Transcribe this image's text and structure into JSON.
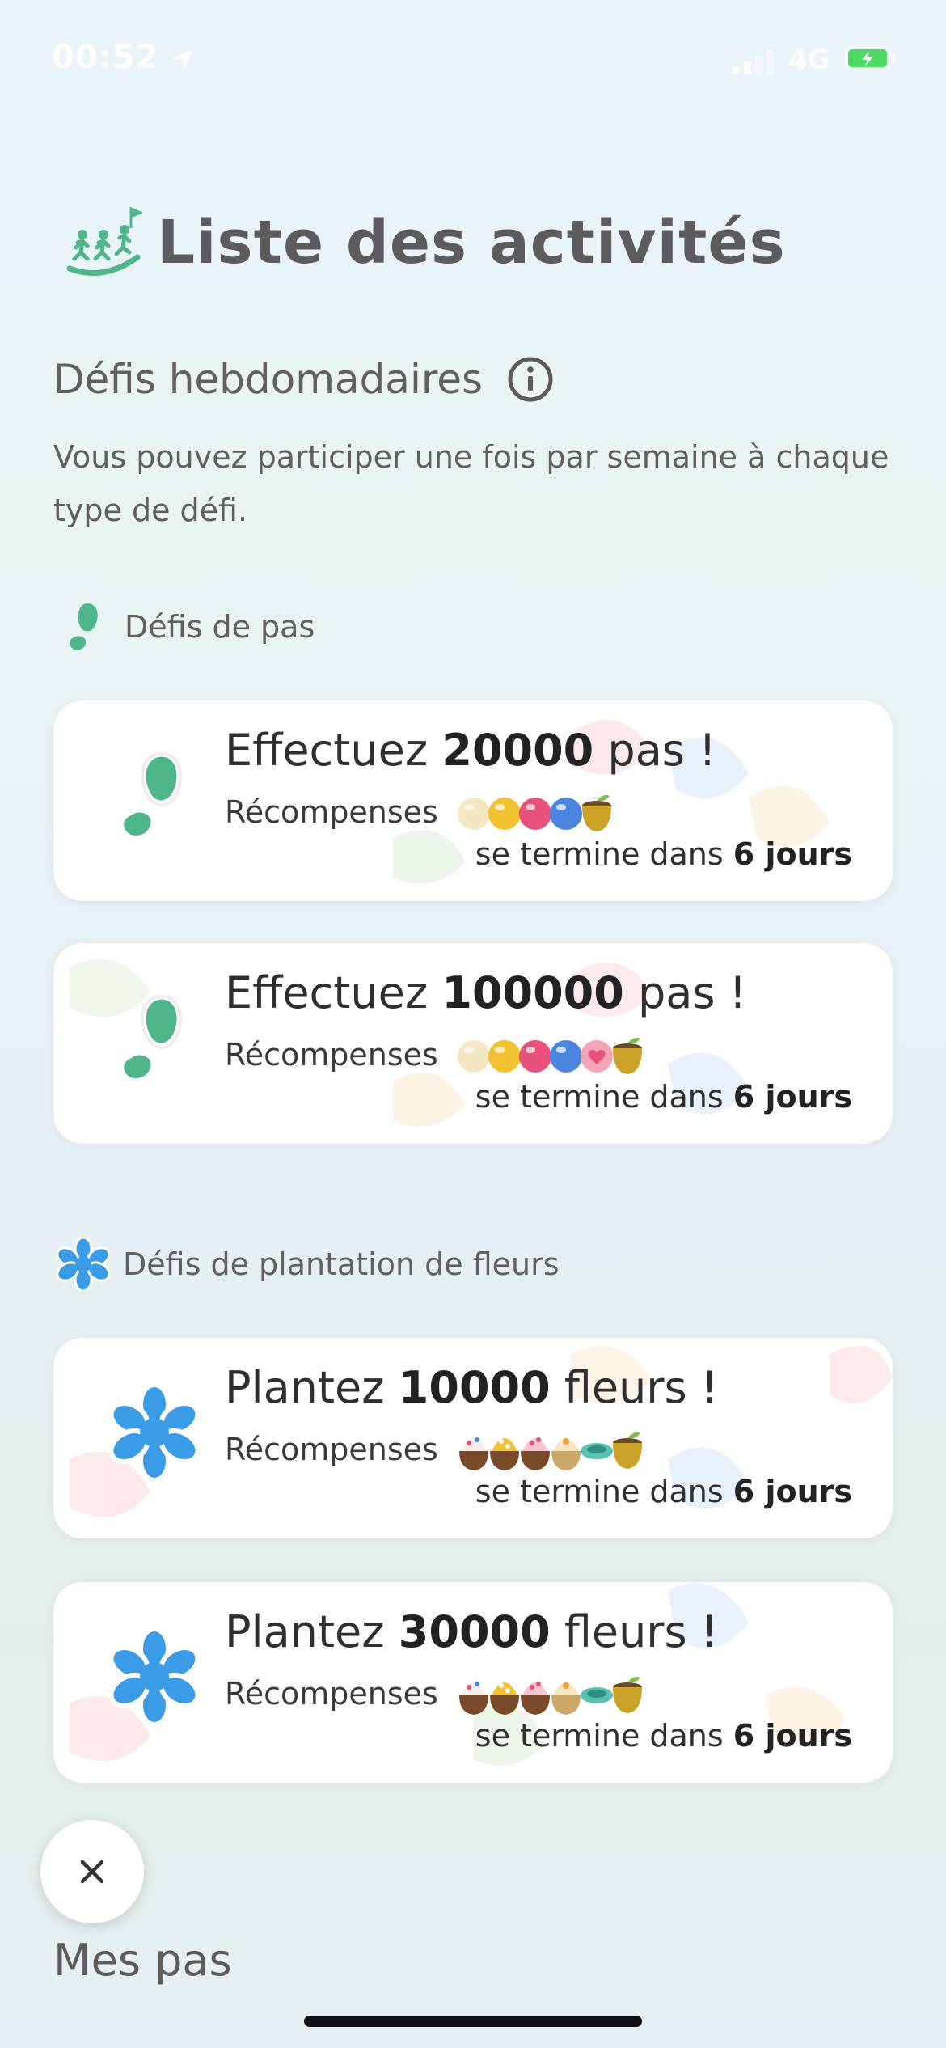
{
  "status_bar": {
    "time": "00:52",
    "network": "4G"
  },
  "header": {
    "title": "Liste des activités",
    "icon": "running-people-icon"
  },
  "weekly": {
    "title": "Défis hebdomadaires",
    "description": "Vous pouvez participer une fois par semaine à chaque type de défi."
  },
  "steps_group": {
    "label": "Défis de pas",
    "cards": [
      {
        "prefix": "Effectuez ",
        "number": "20000",
        "suffix": " pas !",
        "rewards_label": "Récompenses",
        "deadline_prefix": "se termine dans ",
        "deadline_value": "6 jours"
      },
      {
        "prefix": "Effectuez ",
        "number": "100000",
        "suffix": " pas !",
        "rewards_label": "Récompenses",
        "deadline_prefix": "se termine dans ",
        "deadline_value": "6 jours"
      }
    ]
  },
  "flowers_group": {
    "label": "Défis de plantation de fleurs",
    "cards": [
      {
        "prefix": "Plantez ",
        "number": "10000",
        "suffix": " fleurs !",
        "rewards_label": "Récompenses",
        "deadline_prefix": "se termine dans ",
        "deadline_value": "6 jours"
      },
      {
        "prefix": "Plantez ",
        "number": "30000",
        "suffix": " fleurs !",
        "rewards_label": "Récompenses",
        "deadline_prefix": "se termine dans ",
        "deadline_value": "6 jours"
      }
    ]
  },
  "footer": {
    "label": "Mes pas"
  },
  "colors": {
    "accent_green": "#4fb68a",
    "accent_blue": "#3a9be6",
    "title_gray": "#5c5c5c"
  }
}
